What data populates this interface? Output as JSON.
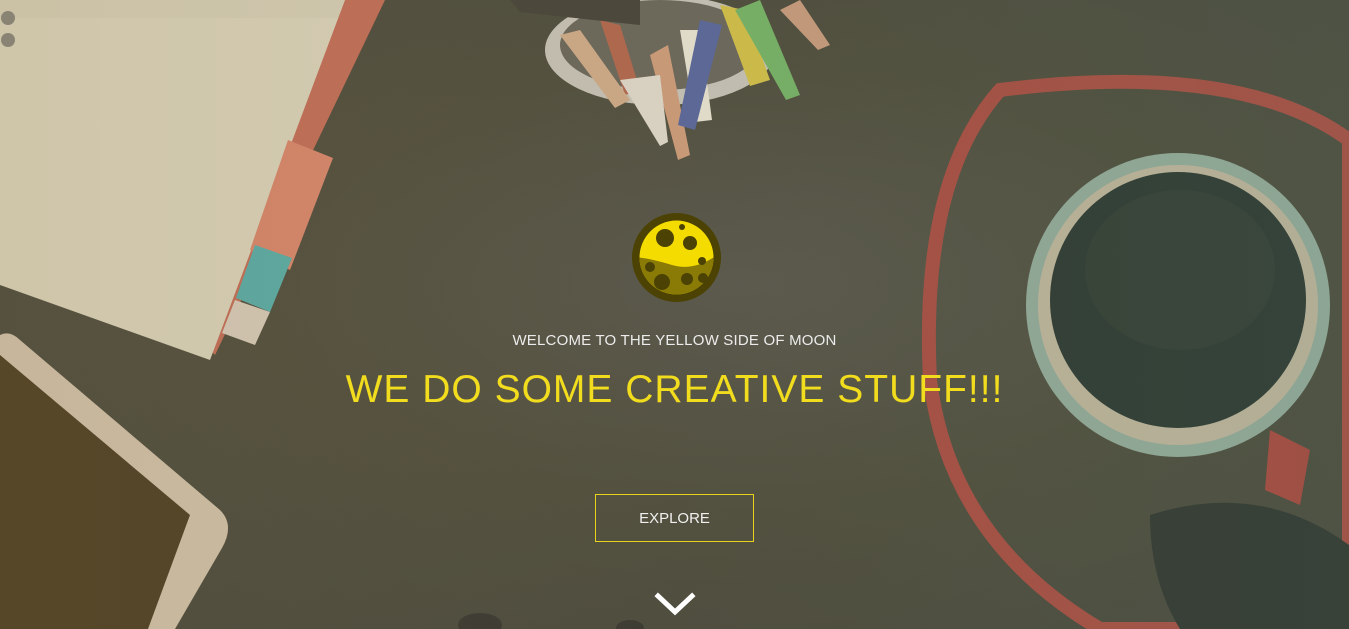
{
  "hero": {
    "tagline": "WELCOME TO THE YELLOW SIDE OF MOON",
    "headline": "WE DO SOME CREATIVE STUFF!!!",
    "explore_label": "EXPLORE"
  },
  "icons": {
    "logo": "moon-logo-icon",
    "scroll": "chevron-down-icon"
  },
  "colors": {
    "accent": "#f2dc1e",
    "text": "#ececec",
    "logo_dark": "#4b4203",
    "logo_yellow": "#f5dc00"
  }
}
